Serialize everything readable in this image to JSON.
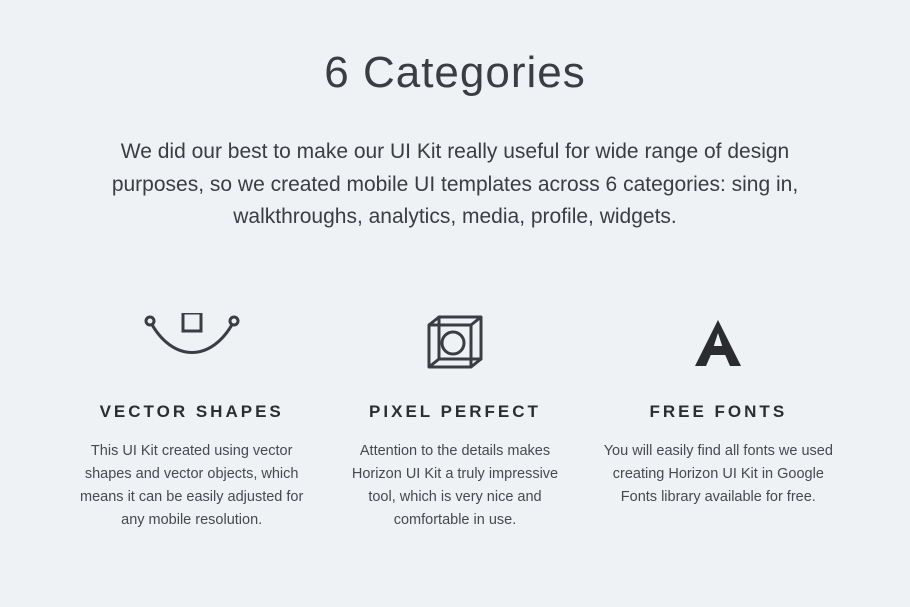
{
  "heading": "6 Categories",
  "subtitle": "We did our best to make our UI Kit really useful for wide range of design purposes, so we created mobile UI templates across 6 categories: sing in, walkthroughs, analytics, media, profile, widgets.",
  "features": [
    {
      "icon": "vector-pen-icon",
      "title": "VECTOR SHAPES",
      "text": "This UI Kit created using vector shapes and vector objects, which means it can be easily adjusted for any mobile resolution."
    },
    {
      "icon": "cube-icon",
      "title": "PIXEL PERFECT",
      "text": "Attention to the details makes Horizon UI Kit a truly impressive tool, which is very nice and comfortable in use."
    },
    {
      "icon": "letter-a-icon",
      "title": "FREE FONTS",
      "text": "You will easily find all fonts we used creating Horizon UI Kit in Google Fonts library available for free."
    }
  ]
}
